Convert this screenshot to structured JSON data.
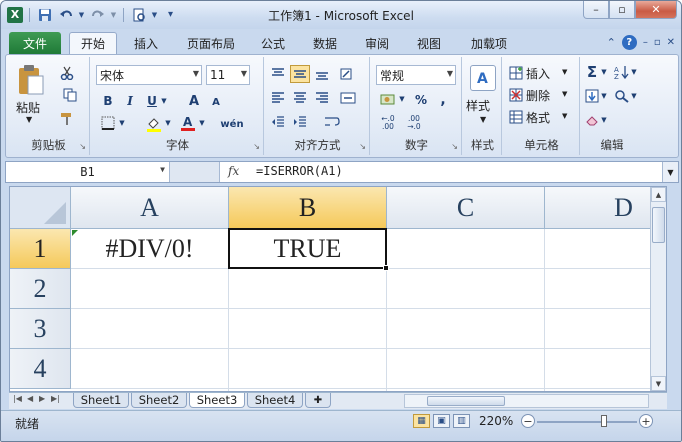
{
  "window": {
    "title": "工作簿1 - Microsoft Excel",
    "app_icon": "X",
    "minimize_glyph": "–",
    "maximize_glyph": "▫",
    "close_glyph": "✕"
  },
  "quick_access": {
    "items": [
      "save-icon",
      "undo-icon",
      "redo-icon",
      "print-preview-icon",
      "customize-qat-icon"
    ]
  },
  "tabs": {
    "file": "文件",
    "items": [
      "开始",
      "插入",
      "页面布局",
      "公式",
      "数据",
      "审阅",
      "视图",
      "加载项"
    ],
    "active": "开始"
  },
  "ribbon": {
    "clipboard": {
      "label": "剪贴板",
      "paste": "粘贴"
    },
    "font": {
      "label": "字体",
      "font_name": "宋体",
      "font_size": "11",
      "bold": "B",
      "italic": "I",
      "underline": "U",
      "grow": "A",
      "shrink": "A",
      "wen": "wén"
    },
    "alignment": {
      "label": "对齐方式"
    },
    "number": {
      "label": "数字",
      "format": "常规",
      "percent": "%",
      "comma": ",",
      "inc_decimal": "←.0 .00",
      "dec_decimal": ".00 →.0"
    },
    "styles": {
      "label": "样式",
      "button": "样式"
    },
    "cells": {
      "label": "单元格",
      "insert": "插入",
      "delete": "删除",
      "format": "格式"
    },
    "editing": {
      "label": "编辑",
      "sum": "Σ"
    }
  },
  "formula_bar": {
    "name_box": "B1",
    "fx": "fx",
    "formula": "=ISERROR(A1)"
  },
  "grid": {
    "columns": [
      "A",
      "B",
      "C",
      "D"
    ],
    "rows": [
      "1",
      "2",
      "3",
      "4"
    ],
    "selected_column": "B",
    "selected_row": "1",
    "cells": {
      "A1": "#DIV/0!",
      "B1": "TRUE"
    }
  },
  "sheet_tabs": {
    "items": [
      "Sheet1",
      "Sheet2",
      "Sheet3",
      "Sheet4"
    ],
    "active": "Sheet3"
  },
  "status_bar": {
    "ready": "就绪",
    "zoom": "220%"
  },
  "colors": {
    "accent_green": "#217346",
    "selected_header": "#f5c95a",
    "grid_line": "#d4dde8"
  }
}
